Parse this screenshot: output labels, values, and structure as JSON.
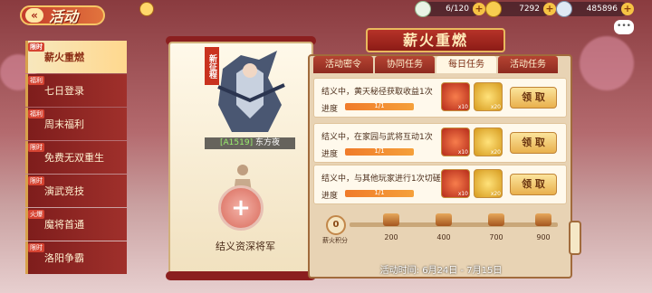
{
  "header": {
    "back_title": "活动",
    "resources": [
      {
        "icon": "jade-icon",
        "value": "6/120"
      },
      {
        "icon": "gold-ingot-icon",
        "value": "7292"
      },
      {
        "icon": "silver-coin-icon",
        "value": "485896"
      }
    ],
    "chat_icon": "chat-bubble-icon"
  },
  "sidebar": {
    "items": [
      {
        "tag": "限时",
        "label": "薪火重燃",
        "active": true
      },
      {
        "tag": "福利",
        "label": "七日登录",
        "active": false
      },
      {
        "tag": "福利",
        "label": "周末福利",
        "active": false
      },
      {
        "tag": "限时",
        "label": "免费无双重生",
        "active": false
      },
      {
        "tag": "限时",
        "label": "演武竞技",
        "active": false
      },
      {
        "tag": "火爆",
        "label": "魔将首通",
        "active": false
      },
      {
        "tag": "限时",
        "label": "洛阳争霸",
        "active": false
      }
    ]
  },
  "card": {
    "badge": "新征程",
    "hero_code": "[A1519]",
    "hero_name": "东方夜",
    "caption": "结义资深将军"
  },
  "panel": {
    "title": "薪火重燃",
    "tabs": [
      {
        "label": "活动密令",
        "active": false
      },
      {
        "label": "协同任务",
        "active": false
      },
      {
        "label": "每日任务",
        "active": true
      },
      {
        "label": "活动任务",
        "active": false
      }
    ],
    "progress_label": "进度",
    "claim_label": "领 取",
    "tasks": [
      {
        "desc": "结义中，黄天秘径获取收益1次",
        "progress": "1/1",
        "progress_fraction": 1,
        "rewards": [
          {
            "icon": "fire-icon",
            "qty": "x10"
          },
          {
            "icon": "gold-ingot-icon",
            "qty": "x20"
          }
        ]
      },
      {
        "desc": "结义中，在家园与武将互动1次",
        "progress": "1/1",
        "progress_fraction": 1,
        "rewards": [
          {
            "icon": "fire-icon",
            "qty": "x10"
          },
          {
            "icon": "gold-ingot-icon",
            "qty": "x20"
          }
        ]
      },
      {
        "desc": "结义中，与其他玩家进行1次切磋",
        "progress": "1/1",
        "progress_fraction": 1,
        "rewards": [
          {
            "icon": "fire-icon",
            "qty": "x10"
          },
          {
            "icon": "gold-ingot-icon",
            "qty": "x20"
          }
        ]
      }
    ],
    "score": {
      "value": "0",
      "label": "薪火积分"
    },
    "milestones": [
      "200",
      "400",
      "700",
      "900"
    ],
    "dates": "活动时间: 6月24日 - 7月15日"
  }
}
